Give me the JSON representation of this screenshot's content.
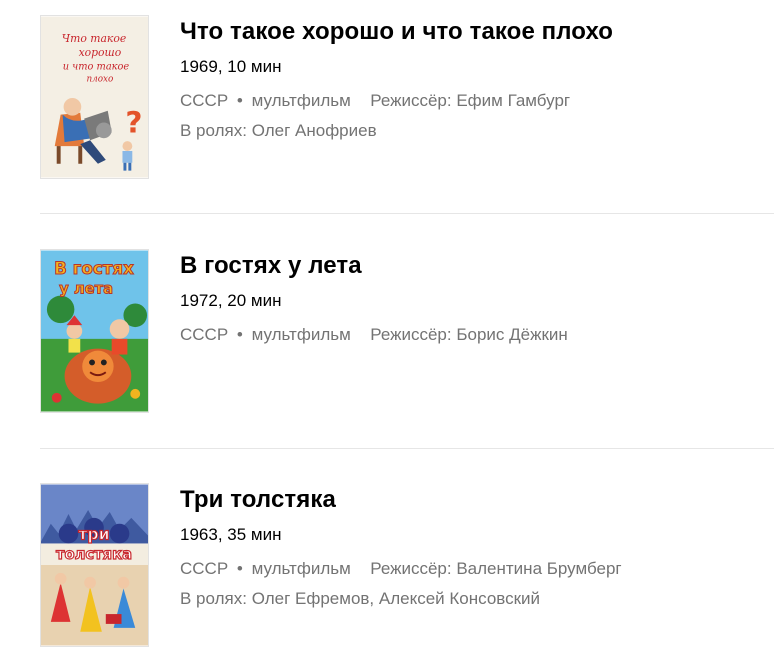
{
  "films": [
    {
      "poster_text": [
        "Что такое",
        "хорошо",
        "и что такое",
        "плохо"
      ],
      "title": "Что такое хорошо и что такое плохо",
      "year_duration": "1969, 10 мин",
      "country": "СССР",
      "separator": "•",
      "genre": "мультфильм",
      "director_label": "Режиссёр:",
      "director": "Ефим Гамбург",
      "cast_label": "В ролях:",
      "cast": "Олег Анофриев"
    },
    {
      "poster_text": [
        "В гостях",
        "у лета"
      ],
      "title": "В гостях у лета",
      "year_duration": "1972, 20 мин",
      "country": "СССР",
      "separator": "•",
      "genre": "мультфильм",
      "director_label": "Режиссёр:",
      "director": "Борис Дёжкин"
    },
    {
      "poster_text": [
        "три",
        "толстяка"
      ],
      "title": "Три толстяка",
      "year_duration": "1963, 35 мин",
      "country": "СССР",
      "separator": "•",
      "genre": "мультфильм",
      "director_label": "Режиссёр:",
      "director": "Валентина Брумберг",
      "cast_label": "В ролях:",
      "cast": "Олег Ефремов, Алексей Консовский"
    }
  ],
  "colors": {
    "title": "#000000",
    "meta": "#737373",
    "divider": "#e6e6e6"
  }
}
